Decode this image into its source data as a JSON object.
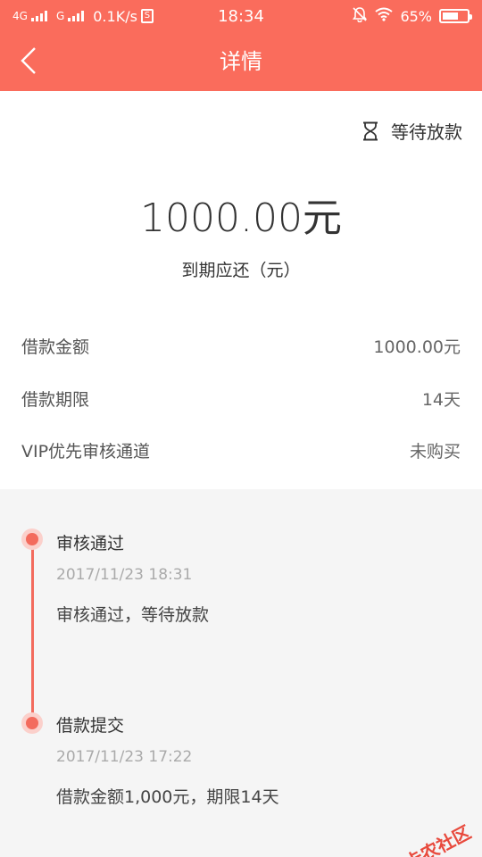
{
  "status_bar": {
    "network1": "4G",
    "network2": "G",
    "speed": "0.1K/s",
    "sim_mark": "S",
    "time": "18:34",
    "battery": "65%",
    "battery_level": 0.65
  },
  "header": {
    "title": "详情"
  },
  "summary": {
    "status": "等待放款",
    "amount": "1000.00元",
    "amount_label": "到期应还（元）",
    "rows": [
      {
        "label": "借款金额",
        "value": "1000.00元"
      },
      {
        "label": "借款期限",
        "value": "14天"
      },
      {
        "label": "VIP优先审核通道",
        "value": "未购买"
      }
    ]
  },
  "timeline": [
    {
      "title": "审核通过",
      "time": "2017/11/23 18:31",
      "desc": "审核通过，等待放款"
    },
    {
      "title": "借款提交",
      "time": "2017/11/23 17:22",
      "desc": "借款金额1,000元，期限14天"
    }
  ],
  "watermark": {
    "text": "卡农社区"
  },
  "colors": {
    "accent": "#fa6c5c",
    "timeline": "#f36b5d"
  }
}
